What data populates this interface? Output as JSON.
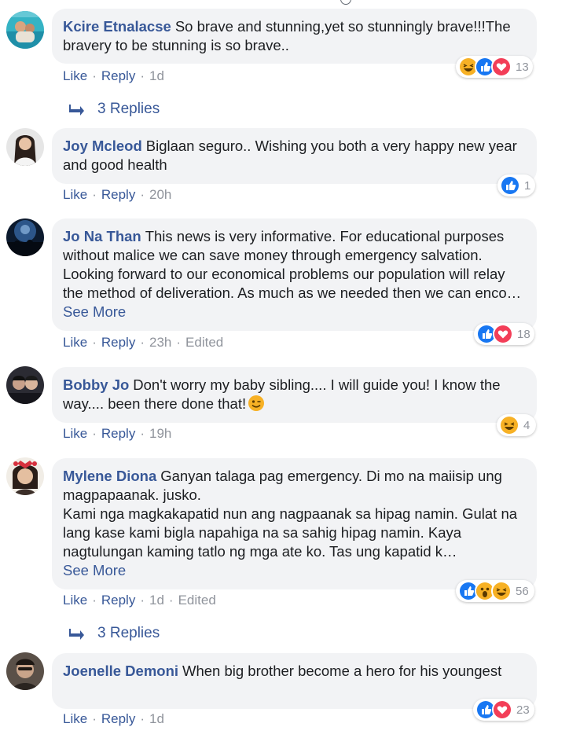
{
  "action_labels": {
    "like": "Like",
    "reply": "Reply",
    "edited": "Edited"
  },
  "colors": {
    "link": "#385898",
    "meta": "#90949c",
    "bubble": "#f2f3f5",
    "like_blue": "#1877f2",
    "love_red": "#f33e58",
    "haha_yellow": "#f7b125"
  },
  "comments": [
    {
      "author": "Kcire Etnalacse",
      "text": "So brave and stunning,yet so stunningly brave!!!The bravery to be stunning is so brave..",
      "time": "1d",
      "edited": false,
      "reactions": [
        "haha",
        "like",
        "love"
      ],
      "reaction_count": "13",
      "replies_label": "3 Replies"
    },
    {
      "author": "Joy Mcleod",
      "text": "Biglaan seguro.. Wishing you both a very happy new year and good health",
      "time": "20h",
      "edited": false,
      "reactions": [
        "like"
      ],
      "reaction_count": "1"
    },
    {
      "author": "Jo Na Than",
      "text": "This news is very informative. For educational purposes without malice we can save money through emergency salvation. Looking forward to our economical problems our population will relay the method of deliveration. As much as we needed then we can enco…",
      "see_more": "See More",
      "time": "23h",
      "edited": true,
      "reactions": [
        "like",
        "love"
      ],
      "reaction_count": "18"
    },
    {
      "author": "Bobby Jo",
      "text": "Don't worry my baby sibling.... I will guide you! I know the way.... been there done that!",
      "emoji": "wink-emoji",
      "time": "19h",
      "edited": false,
      "reactions": [
        "haha"
      ],
      "reaction_count": "4"
    },
    {
      "author": "Mylene Diona",
      "text": "Ganyan talaga pag emergency. Di mo na maiisip ung magpapaanak. jusko.\nKami nga magkakapatid nun ang nagpaanak sa hipag namin. Gulat na lang kase kami bigla napahiga na sa sahig hipag namin. Kaya nagtulungan kaming tatlo ng mga ate ko. Tas ung kapatid k…",
      "see_more": "See More",
      "time": "1d",
      "edited": true,
      "reactions": [
        "like",
        "wow",
        "haha"
      ],
      "reaction_count": "56",
      "replies_label": "3 Replies"
    },
    {
      "author": "Joenelle Demoni",
      "text": "When big brother become a hero for his youngest",
      "time": "1d",
      "edited": false,
      "reactions": [
        "like",
        "love"
      ],
      "reaction_count": "23"
    }
  ]
}
